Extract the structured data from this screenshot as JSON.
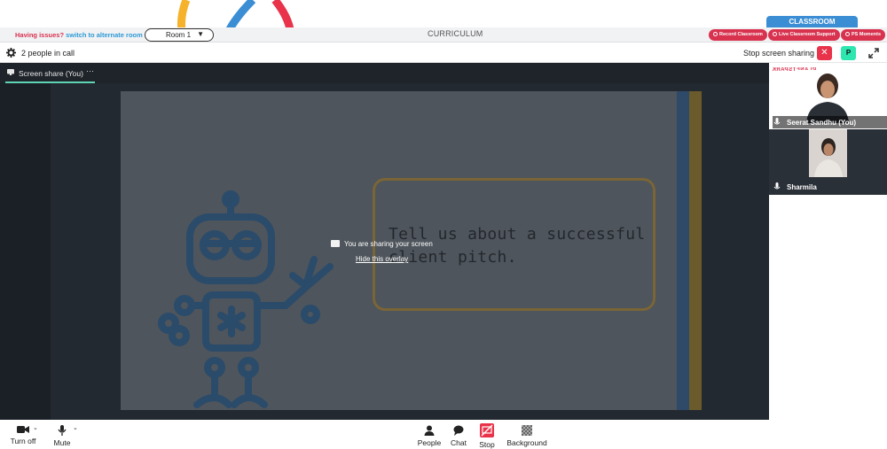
{
  "banner": {
    "issues_text": "Having issues?",
    "alt_room_link": "switch to alternate room",
    "room_select_value": "Room 1",
    "curriculum_label": "CURRICULUM",
    "classroom_tab": "CLASSROOM",
    "pills": {
      "record": "Record Classroom",
      "support": "Live Classroom Support",
      "moments": "PS Moments"
    }
  },
  "meet": {
    "people_count": "2 people in call",
    "stop_sharing_label": "Stop screen sharing",
    "presenter_badge": "P",
    "tab_label": "Screen share (You)",
    "tab_more": "···"
  },
  "slide": {
    "text": "Tell us about a successful client pitch."
  },
  "overlay": {
    "message": "You are sharing your screen",
    "hide_link": "Hide this overlay"
  },
  "participants": [
    {
      "name": "Seerat Sandhu (You)",
      "brand": "PLANETSPARK"
    },
    {
      "name": "Sharmila"
    }
  ],
  "toolbar": {
    "turn_off": "Turn off",
    "mute": "Mute",
    "people": "People",
    "chat": "Chat",
    "stop": "Stop",
    "background": "Background"
  },
  "colors": {
    "brand_red": "#d8324f",
    "link_blue": "#2d9ad6",
    "classroom_blue": "#3b8ed3",
    "accent_green": "#2ee6b0",
    "stop_red": "#e8334a"
  }
}
